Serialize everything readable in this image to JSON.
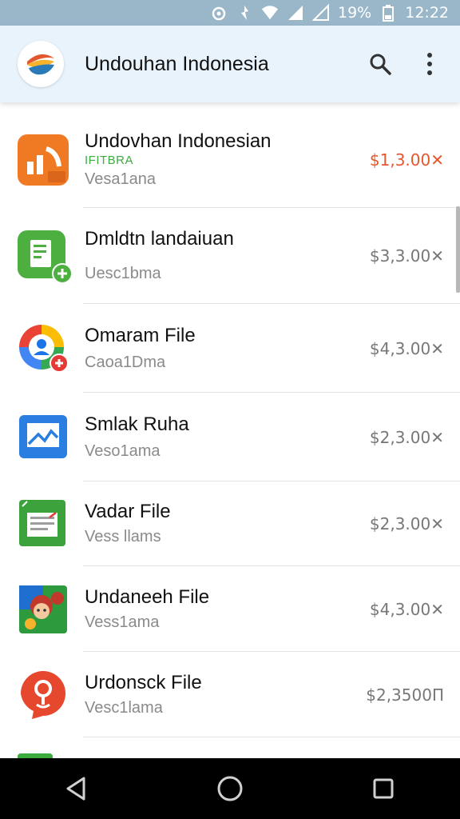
{
  "status_bar": {
    "battery": "19%",
    "time": "12:22"
  },
  "app_bar": {
    "title": "Undouhan Indonesia",
    "logo_icon": "flag-logo-icon",
    "search_icon": "search-icon",
    "more_icon": "more-vert-icon"
  },
  "list": {
    "items": [
      {
        "name": "Undovhan Indonesian",
        "tag": "IFITBRA",
        "sub": "Vesa1ana",
        "price": "$1,3.00✕",
        "icon": "orange-chart-icon",
        "price_color": "#e4572e"
      },
      {
        "name": "Dmldtn landaiuan",
        "tag": "",
        "sub": "Uesc1bma",
        "price": "$3,3.00✕",
        "icon": "green-document-icon",
        "price_color": "#777777"
      },
      {
        "name": "Omaram File",
        "tag": "",
        "sub": "Caoa1Dma",
        "price": "$4,3.00✕",
        "icon": "user-ring-icon",
        "price_color": "#777777"
      },
      {
        "name": "Smlak Ruha",
        "tag": "",
        "sub": "Veso1ama",
        "price": "$2,3.00✕",
        "icon": "blue-image-icon",
        "price_color": "#777777"
      },
      {
        "name": "Vadar File",
        "tag": "",
        "sub": "Vess llams",
        "price": "$2,3.00✕",
        "icon": "green-sheet-icon",
        "price_color": "#777777"
      },
      {
        "name": "Undaneeh File",
        "tag": "",
        "sub": "Vess1ama",
        "price": "$4,3.00✕",
        "icon": "avatar-game-icon",
        "price_color": "#777777"
      },
      {
        "name": "Urdonsck File",
        "tag": "",
        "sub": "Vesc1lama",
        "price": "$2,3500Π",
        "icon": "red-pin-icon",
        "price_color": "#777777"
      }
    ]
  },
  "nav_bar": {
    "back_icon": "back-triangle-icon",
    "home_icon": "home-circle-icon",
    "recents_icon": "recents-square-icon"
  }
}
